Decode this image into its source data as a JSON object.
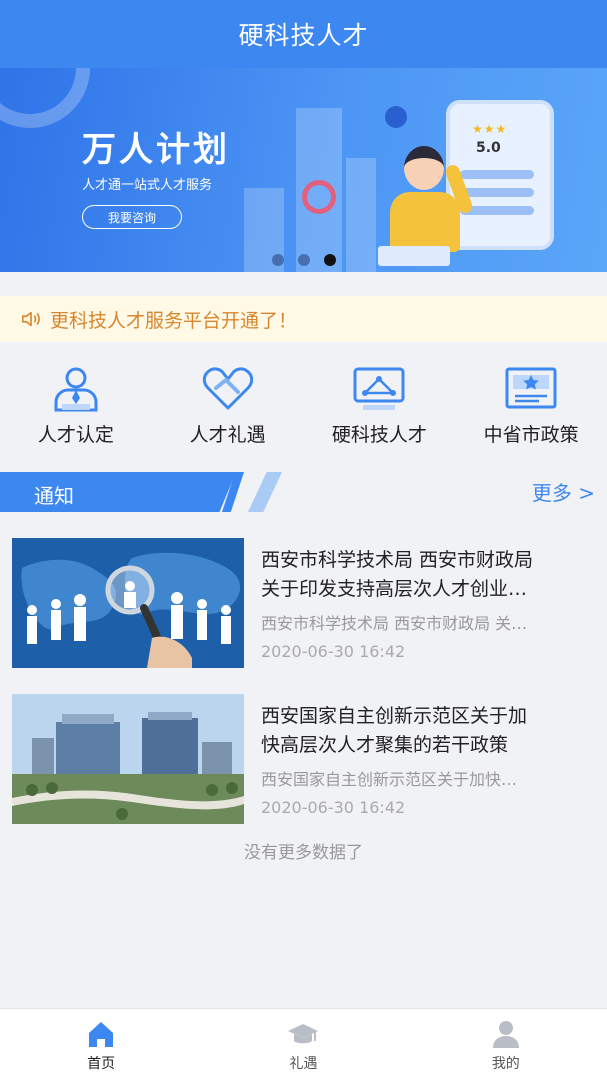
{
  "header": {
    "title": "硬科技人才"
  },
  "banner": {
    "title": "万人计划",
    "subtitle": "人才通一站式人才服务",
    "button": "我要咨询",
    "rating": "5.0",
    "stars": "★★★",
    "slides": 3,
    "active_slide": 3
  },
  "notice": {
    "text": "更科技人才服务平台开通了！",
    "icon": "speaker-icon"
  },
  "quick_menu": [
    {
      "label": "人才认定",
      "icon": "person-id-icon"
    },
    {
      "label": "人才礼遇",
      "icon": "heart-hands-icon"
    },
    {
      "label": "硬科技人才",
      "icon": "screen-network-icon"
    },
    {
      "label": "中省市政策",
      "icon": "star-certificate-icon"
    }
  ],
  "section": {
    "title": "通知",
    "more": "更多 >"
  },
  "news": [
    {
      "title_line1": "西安市科学技术局 西安市财政局",
      "title_line2": "关于印发支持高层次人才创业…",
      "summary": "西安市科学技术局 西安市财政局 关…",
      "time": "2020-06-30 16:42"
    },
    {
      "title_line1": "西安国家自主创新示范区关于加",
      "title_line2": "快高层次人才聚集的若干政策",
      "summary": "西安国家自主创新示范区关于加快…",
      "time": "2020-06-30 16:42"
    }
  ],
  "no_more": "没有更多数据了",
  "tabbar": [
    {
      "label": "首页",
      "icon": "home-icon",
      "active": true
    },
    {
      "label": "礼遇",
      "icon": "graduation-cap-icon",
      "active": false
    },
    {
      "label": "我的",
      "icon": "user-icon",
      "active": false
    }
  ],
  "colors": {
    "primary": "#3d87f0",
    "notice_text": "#d8862e",
    "notice_bg": "#fff9e6"
  }
}
